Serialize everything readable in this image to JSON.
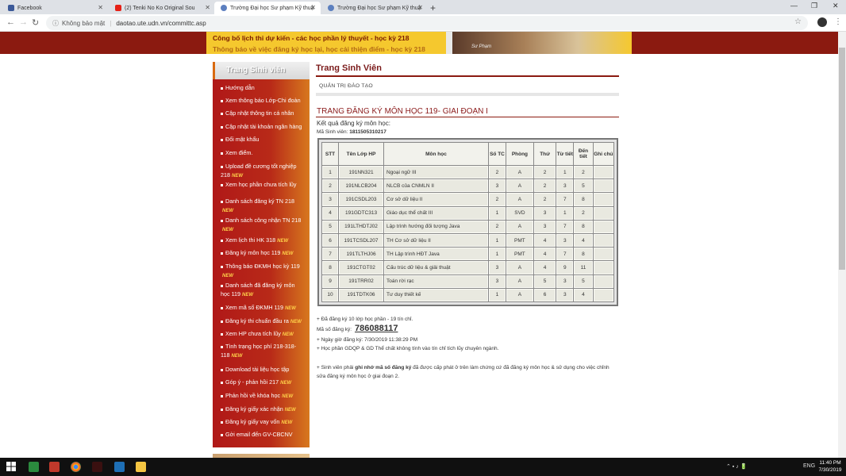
{
  "browser": {
    "tabs": [
      {
        "label": "Facebook",
        "color": "#3b5998"
      },
      {
        "label": "(2) Tenki No Ko Original Sou",
        "color": "#e62117"
      },
      {
        "label": "Trường Đại học Sư phạm Kỹ thuậ",
        "color": "#5c7fbf"
      },
      {
        "label": "Trường Đại học Sư phạm Kỹ thuậ",
        "color": "#5c7fbf"
      }
    ],
    "not_secure": "Không bảo mật",
    "url": "daotao.ute.udn.vn/committc.asp"
  },
  "banner": {
    "marquee1": "Công bố lịch thi dự kiến - các học phần lý thuyết - học kỳ 218",
    "marquee2": "Thông báo về việc đăng ký học lại, học cải thiện điểm - học kỳ 218",
    "photo_caption": "Sư Phạm"
  },
  "sidebar": {
    "heading": "Trang Sinh viên",
    "new_tag": "NEW",
    "items": [
      {
        "label": "Hướng dẫn",
        "is_new": false
      },
      {
        "label": "Xem thông báo Lớp-Chi đoàn",
        "is_new": false
      },
      {
        "label": "Cập nhật thông tin cá nhân",
        "is_new": false
      },
      {
        "label": "Cập nhật tài khoản ngân hàng",
        "is_new": false
      },
      {
        "label": "Đổi mật khẩu",
        "is_new": false
      },
      {
        "label": "Xem điểm.",
        "is_new": false
      },
      {
        "label": "Upload đề cương tốt nghiệp 218",
        "is_new": true
      },
      {
        "label": "Xem học phần chưa tích lũy",
        "is_new": false
      },
      {
        "label": "Danh sách đăng ký TN 218",
        "is_new": true
      },
      {
        "label": "Danh sách công nhận TN 218",
        "is_new": true
      },
      {
        "label": "Xem lịch thi HK 318",
        "is_new": true
      },
      {
        "label": "Đăng ký môn học 119",
        "is_new": true
      },
      {
        "label": "Thông báo ĐKMH học kỳ 119",
        "is_new": true
      },
      {
        "label": "Danh sách đã đăng ký môn học 119",
        "is_new": true
      },
      {
        "label": "Xem mã số ĐKMH 119",
        "is_new": true
      },
      {
        "label": "Đăng ký thi chuẩn đầu ra",
        "is_new": true
      },
      {
        "label": "Xem HP chưa tích lũy",
        "is_new": true
      },
      {
        "label": "Tình trạng học phí 218-318-118",
        "is_new": true
      },
      {
        "label": "Download tài liệu học tập",
        "is_new": false
      },
      {
        "label": "Góp ý - phản hồi 217",
        "is_new": true
      },
      {
        "label": "Phản hồi về khóa học",
        "is_new": true
      },
      {
        "label": "Đăng ký giấy xác nhận",
        "is_new": true
      },
      {
        "label": "Đăng ký giấy vay vốn",
        "is_new": true
      },
      {
        "label": "Gởi email đến GV-CBCNV",
        "is_new": false
      }
    ]
  },
  "main": {
    "title": "Trang Sinh Viên",
    "subheader": "QUẢN TRỊ ĐÀO TẠO",
    "section_title": "TRANG ĐĂNG KÝ MÔN HỌC 119- GIAI ĐOẠN I",
    "result_label": "Kết quả đăng ký môn học:",
    "student_id_label": "Mã Sinh viên:",
    "student_id": "1811505310217",
    "table": {
      "headers": [
        "STT",
        "Tên Lớp HP",
        "Môn học",
        "Số TC",
        "Phòng",
        "Thứ",
        "Từ tiết",
        "Đến tiết",
        "Ghi chú"
      ],
      "rows": [
        [
          "1",
          "191NN321",
          "Ngoại ngữ III",
          "2",
          "A",
          "2",
          "1",
          "2",
          ""
        ],
        [
          "2",
          "191NLCB204",
          "NLCB của CNMLN II",
          "3",
          "A",
          "2",
          "3",
          "5",
          ""
        ],
        [
          "3",
          "191CSDL203",
          "Cơ sở dữ liệu II",
          "2",
          "A",
          "2",
          "7",
          "8",
          ""
        ],
        [
          "4",
          "191GDTC313",
          "Giáo dục thể chất III",
          "1",
          "SVD",
          "3",
          "1",
          "2",
          ""
        ],
        [
          "5",
          "191LTHDTJ02",
          "Lập trình hướng đối tượng Java",
          "2",
          "A",
          "3",
          "7",
          "8",
          ""
        ],
        [
          "6",
          "191TCSDL207",
          "TH Cơ sở dữ liệu II",
          "1",
          "PMT",
          "4",
          "3",
          "4",
          ""
        ],
        [
          "7",
          "191TLTHJ06",
          "TH Lập trình HĐT Java",
          "1",
          "PMT",
          "4",
          "7",
          "8",
          ""
        ],
        [
          "8",
          "191CTGT02",
          "Cấu trúc dữ liệu & giải thuật",
          "3",
          "A",
          "4",
          "9",
          "11",
          ""
        ],
        [
          "9",
          "191TRR02",
          "Toán rời rạc",
          "3",
          "A",
          "5",
          "3",
          "5",
          ""
        ],
        [
          "10",
          "191TDTK06",
          "Tư duy thiết kế",
          "1",
          "A",
          "6",
          "3",
          "4",
          ""
        ]
      ]
    },
    "summary": "+ Đã đăng ký 10 lớp học phần - 19 tín chỉ.",
    "code_label": "Mã số đăng ký:",
    "code_value": "786088117",
    "reg_time": "+ Ngày giờ đăng ký: 7/30/2019 11:38:29 PM",
    "gdqp_note": "+ Học phần GDQP & GD Thể chất không tính vào tín chỉ tích lũy chuyên ngành.",
    "reminder_prefix": "+ Sinh viên phải",
    "reminder_bold": "ghi nhớ mã số đăng ký",
    "reminder_rest": "đã được cấp phát ở trên làm chứng cứ đã đăng ký môn học & sử dụng cho việc chỉnh",
    "reminder_line2": "sửa đăng ký môn học ở giai đoạn 2."
  },
  "taskbar": {
    "lang": "ENG",
    "time": "11:40 PM",
    "date": "7/30/2019"
  }
}
